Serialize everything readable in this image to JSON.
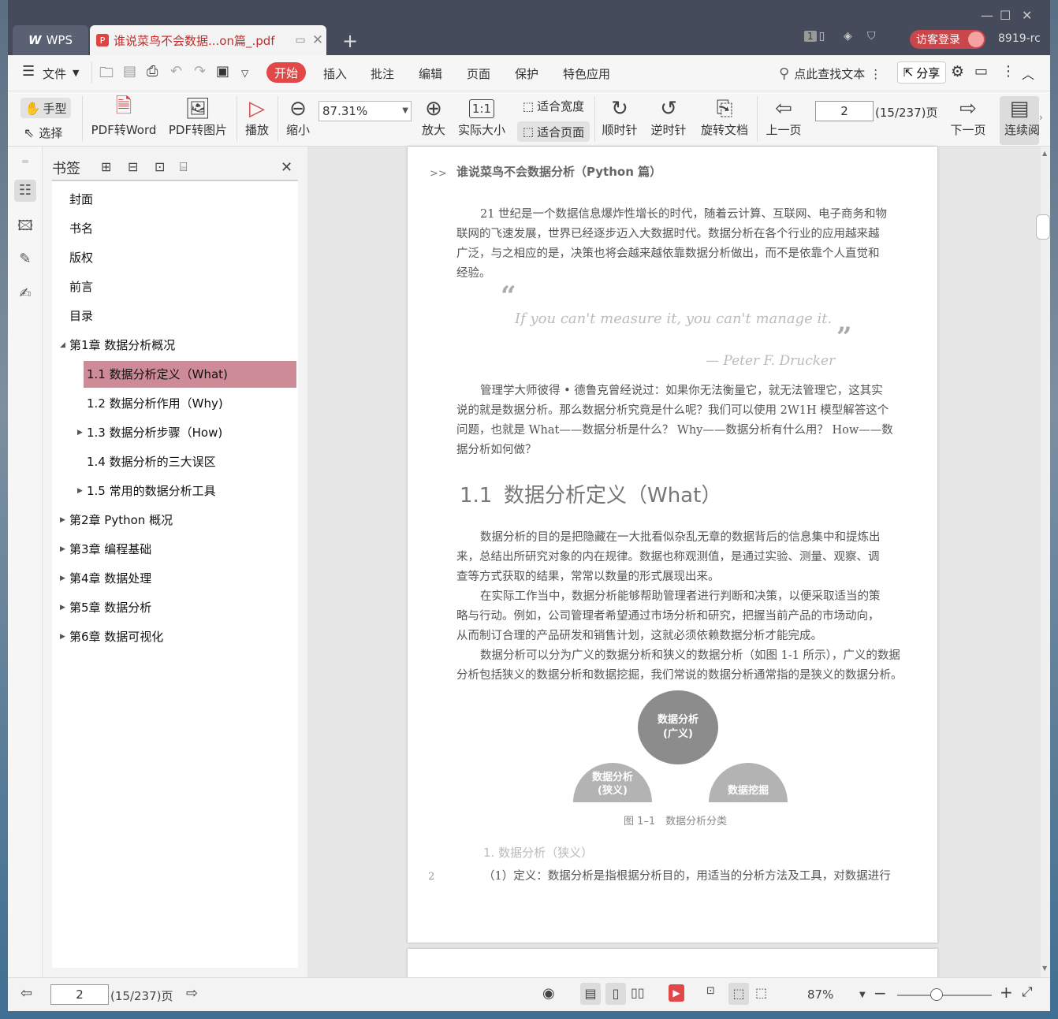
{
  "titlebar": {
    "app_tab": "WPS",
    "doc_tab": "谁说菜鸟不会数据...on篇_.pdf",
    "badge": "1",
    "visitor": "访客登录",
    "version": "8919-rc"
  },
  "menubar": {
    "file": "文件",
    "tabs": [
      "开始",
      "插入",
      "批注",
      "编辑",
      "页面",
      "保护",
      "特色应用"
    ],
    "search": "点此查找文本",
    "share": "分享"
  },
  "toolbar": {
    "hand": "手型",
    "select": "选择",
    "pdf_to_word": "PDF转Word",
    "pdf_to_image": "PDF转图片",
    "play": "播放",
    "zoom_out": "缩小",
    "zoom_value": "87.31%",
    "zoom_in": "放大",
    "actual_size": "实际大小",
    "fit_width": "适合宽度",
    "fit_page": "适合页面",
    "clockwise": "顺时针",
    "counterclockwise": "逆时针",
    "rotate_doc": "旋转文档",
    "prev_page": "上一页",
    "page_value": "2",
    "page_total": "(15/237)页",
    "next_page": "下一页",
    "continuous": "连续阅"
  },
  "bookmarks": {
    "title": "书签",
    "items": [
      {
        "label": "封面",
        "level": 0,
        "expandable": false
      },
      {
        "label": "书名",
        "level": 0,
        "expandable": false
      },
      {
        "label": "版权",
        "level": 0,
        "expandable": false
      },
      {
        "label": "前言",
        "level": 0,
        "expandable": false
      },
      {
        "label": "目录",
        "level": 0,
        "expandable": false
      },
      {
        "label": "第1章 数据分析概况",
        "level": 0,
        "expandable": true,
        "expanded": true
      },
      {
        "label": "1.1 数据分析定义（What)",
        "level": 1,
        "expandable": false,
        "selected": true
      },
      {
        "label": "1.2 数据分析作用（Why)",
        "level": 1,
        "expandable": false
      },
      {
        "label": "1.3 数据分析步骤（How)",
        "level": 1,
        "expandable": true
      },
      {
        "label": "1.4 数据分析的三大误区",
        "level": 1,
        "expandable": false
      },
      {
        "label": "1.5 常用的数据分析工具",
        "level": 1,
        "expandable": true
      },
      {
        "label": "第2章 Python 概况",
        "level": 0,
        "expandable": true
      },
      {
        "label": "第3章 编程基础",
        "level": 0,
        "expandable": true
      },
      {
        "label": "第4章 数据处理",
        "level": 0,
        "expandable": true
      },
      {
        "label": "第5章 数据分析",
        "level": 0,
        "expandable": true
      },
      {
        "label": "第6章 数据可视化",
        "level": 0,
        "expandable": true
      }
    ]
  },
  "page": {
    "header_mark": ">>",
    "header": "谁说菜鸟不会数据分析（Python 篇）",
    "para1": [
      "21 世纪是一个数据信息爆炸性增长的时代，随着云计算、互联网、电子商务和物",
      "联网的飞速发展，世界已经逐步迈入大数据时代。数据分析在各个行业的应用越来越",
      "广泛，与之相应的是，决策也将会越来越依靠数据分析做出，而不是依靠个人直觉和",
      "经验。"
    ],
    "quote": "If you can't measure it, you can't manage it.",
    "quote_author": "— Peter F. Drucker",
    "para2": [
      "管理学大师彼得 • 德鲁克曾经说过：如果你无法衡量它，就无法管理它，这其实",
      "说的就是数据分析。那么数据分析究竟是什么呢？我们可以使用 2W1H 模型解答这个",
      "问题，也就是 What——数据分析是什么？ Why——数据分析有什么用？ How——数",
      "据分析如何做？"
    ],
    "section_num": "1.1",
    "section_title": "数据分析定义（What）",
    "para3": [
      "数据分析的目的是把隐藏在一大批看似杂乱无章的数据背后的信息集中和提炼出",
      "来，总结出所研究对象的内在规律。数据也称观测值，是通过实验、测量、观察、调",
      "查等方式获取的结果，常常以数量的形式展现出来。",
      "在实际工作当中，数据分析能够帮助管理者进行判断和决策，以便采取适当的策",
      "略与行动。例如，公司管理者希望通过市场分析和研究，把握当前产品的市场动向，",
      "从而制订合理的产品研发和销售计划，这就必须依赖数据分析才能完成。",
      "数据分析可以分为广义的数据分析和狭义的数据分析（如图 1-1 所示），广义的数据",
      "分析包括狭义的数据分析和数据挖掘，我们常说的数据分析通常指的是狭义的数据分析。"
    ],
    "diagram": {
      "top_l1": "数据分析",
      "top_l2": "(广义)",
      "left_l1": "数据分析",
      "left_l2": "(狭义)",
      "right": "数据挖掘",
      "caption": "图 1–1　数据分析分类"
    },
    "subhead": "1. 数据分析（狭义）",
    "page_no": "2",
    "last_line": "（1）定义：数据分析是指根据分析目的，用适当的分析方法及工具，对数据进行"
  },
  "statusbar": {
    "page_value": "2",
    "page_total": "(15/237)页",
    "zoom": "87%"
  }
}
